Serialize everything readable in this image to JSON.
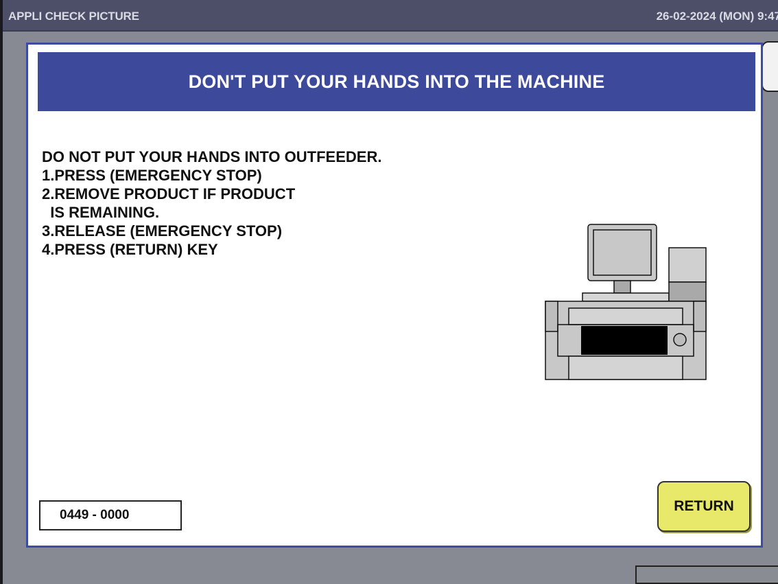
{
  "topbar": {
    "app_title": "APPLI CHECK PICTURE",
    "datetime": "26-02-2024 (MON)  9:47"
  },
  "dialog": {
    "title": "DON'T PUT YOUR HANDS INTO THE MACHINE",
    "instructions": [
      "DO NOT PUT YOUR HANDS INTO OUTFEEDER.",
      "1.PRESS (EMERGENCY STOP)",
      "2.REMOVE PRODUCT IF PRODUCT",
      "  IS REMAINING.",
      "3.RELEASE (EMERGENCY STOP)",
      "4.PRESS (RETURN) KEY"
    ],
    "illustration_icon": "machine-illustration",
    "code": "0449 - 0000",
    "return_label": "RETURN"
  },
  "colors": {
    "topbar_bg": "#4c4f67",
    "header_bg": "#3d4a9c",
    "return_btn_bg": "#e8e86a",
    "screen_bg": "#878a92"
  }
}
